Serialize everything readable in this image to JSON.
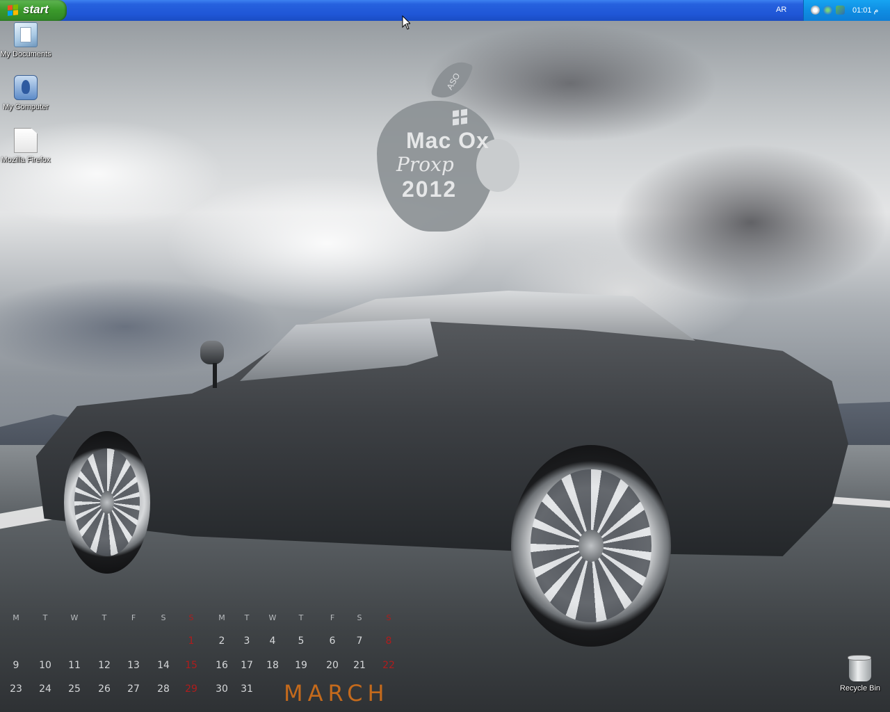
{
  "taskbar": {
    "start_label": "start",
    "language": "AR",
    "clock": "01:01 م",
    "tray_icons": [
      "network-icon",
      "globe-icon",
      "security-icon"
    ]
  },
  "desktop_icons": {
    "my_documents": "My Documents",
    "my_computer": "My Computer",
    "mozilla_firefox": "Mozilla Firefox",
    "recycle_bin": "Recycle Bin"
  },
  "wallpaper": {
    "logo_leaf": "ASO",
    "logo_line1": "Mac Ox",
    "logo_line2": "Proxp",
    "logo_line3": "2012",
    "calendar": {
      "month": "MARCH",
      "weekdays": [
        "M",
        "T",
        "W",
        "T",
        "F",
        "S",
        "S",
        "M",
        "T",
        "W",
        "T",
        "F",
        "S",
        "S"
      ],
      "row1": [
        "",
        "",
        "",
        "",
        "",
        "",
        "1",
        "2",
        "3",
        "4",
        "5",
        "6",
        "7",
        "8"
      ],
      "row2": [
        "9",
        "10",
        "11",
        "12",
        "13",
        "14",
        "15",
        "16",
        "17",
        "18",
        "19",
        "20",
        "21",
        "22"
      ],
      "row3": [
        "23",
        "24",
        "25",
        "26",
        "27",
        "28",
        "29",
        "30",
        "31",
        "",
        "",
        "",
        "",
        ""
      ],
      "sunday_color": "#b01c1c",
      "month_color": "#c46a1c"
    }
  },
  "colors": {
    "taskbar_blue": "#2661de",
    "start_green": "#3c9b2c",
    "tray_blue": "#0f8ee3"
  }
}
